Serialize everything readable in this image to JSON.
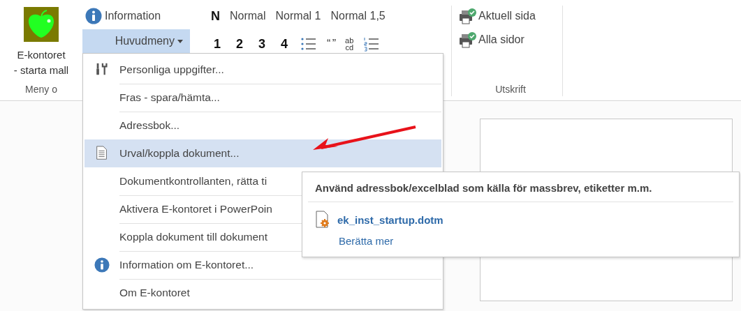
{
  "ribbon": {
    "groups": [
      {
        "kind": "launcher",
        "label": "Meny o",
        "button": {
          "lines": [
            "E-kontoret",
            "- starta mall"
          ]
        }
      },
      {
        "kind": "menu",
        "buttons": [
          {
            "kind": "info",
            "label": "Information"
          },
          {
            "kind": "dropdown",
            "label": "Huvudmeny",
            "expanded": true
          }
        ]
      },
      {
        "kind": "styles",
        "style_buttons": [
          {
            "kind": "bold",
            "label": "N"
          },
          {
            "kind": "text",
            "label": "Normal"
          },
          {
            "kind": "text",
            "label": "Normal 1"
          },
          {
            "kind": "text",
            "label": "Normal 1,5"
          }
        ],
        "format_buttons": [
          {
            "kind": "heading",
            "label": "1"
          },
          {
            "kind": "heading",
            "label": "2"
          },
          {
            "kind": "heading",
            "label": "3"
          },
          {
            "kind": "heading",
            "label": "4"
          },
          {
            "kind": "bullets"
          },
          {
            "kind": "quote",
            "label": "“ ”"
          },
          {
            "kind": "stack",
            "lines": [
              "ab",
              "cd"
            ]
          },
          {
            "kind": "numbers"
          }
        ]
      },
      {
        "kind": "print",
        "label": "Utskrift",
        "buttons": [
          {
            "label": "Aktuell sida"
          },
          {
            "label": "Alla sidor"
          }
        ]
      }
    ]
  },
  "menu": {
    "items": [
      {
        "kind": "tools",
        "label": "Personliga uppgifter...",
        "selected": false
      },
      {
        "label": "Fras - spara/hämta...",
        "selected": false
      },
      {
        "label": "Adressbok...",
        "selected": false
      },
      {
        "kind": "doc",
        "label": "Urval/koppla dokument...",
        "selected": true
      },
      {
        "label": "Dokumentkontrollanten, rätta ti",
        "selected": false
      },
      {
        "label": "Aktivera E-kontoret i PowerPoin",
        "selected": false
      },
      {
        "label": "Koppla dokument till dokument",
        "selected": false
      },
      {
        "kind": "info",
        "label": "Information om E-kontoret...",
        "selected": false
      },
      {
        "label": "Om E-kontoret",
        "selected": false
      }
    ]
  },
  "tooltip": {
    "title": "Använd adressbok/excelblad som källa för massbrev, etiketter m.m.",
    "file": "ek_inst_startup.dotm",
    "link": "Berätta mer"
  }
}
